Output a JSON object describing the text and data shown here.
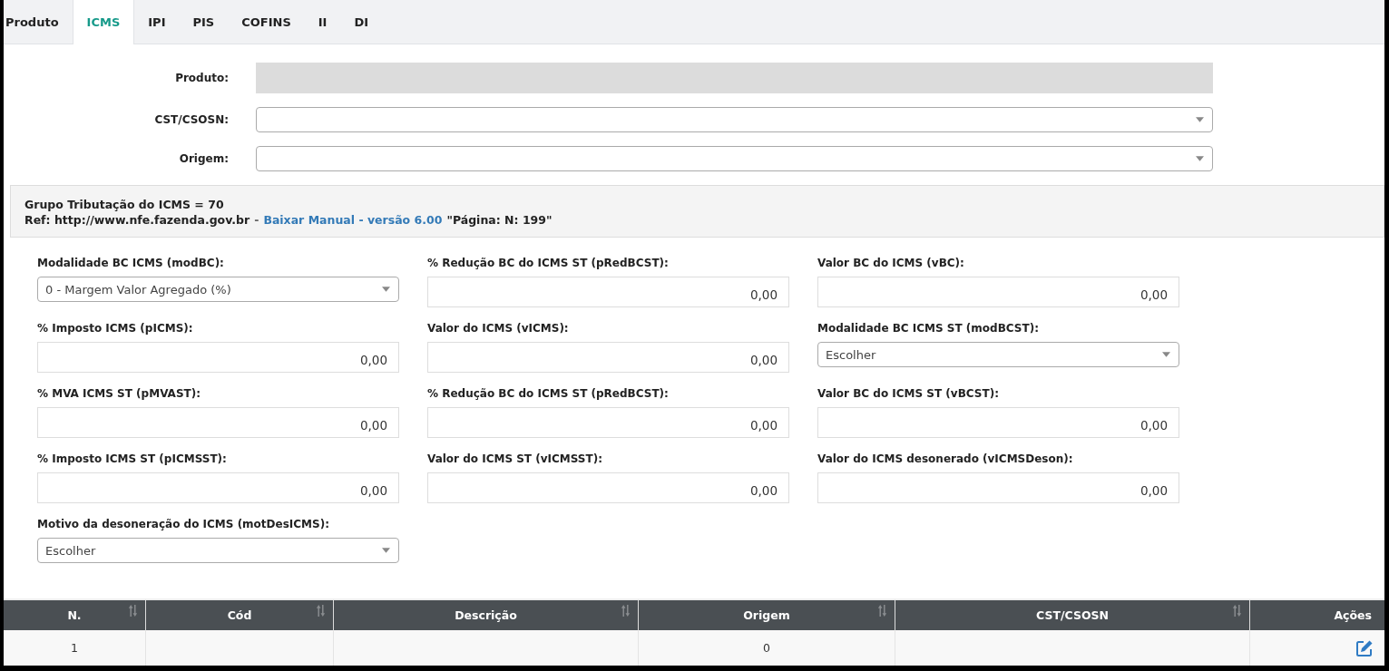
{
  "tabs": [
    {
      "label": "Produto",
      "selected": false
    },
    {
      "label": "ICMS",
      "selected": true
    },
    {
      "label": "IPI",
      "selected": false
    },
    {
      "label": "PIS",
      "selected": false
    },
    {
      "label": "COFINS",
      "selected": false
    },
    {
      "label": "II",
      "selected": false
    },
    {
      "label": "DI",
      "selected": false
    }
  ],
  "header_fields": [
    {
      "label": "Produto:",
      "kind": "text",
      "disabled": true
    },
    {
      "label": "CST/CSOSN:",
      "kind": "select",
      "disabled": false
    },
    {
      "label": "Origem:",
      "kind": "select",
      "disabled": false
    }
  ],
  "info_panel": {
    "title": "Grupo Tributação do ICMS = 70",
    "ref_prefix": "Ref: http://www.nfe.fazenda.gov.br",
    "separator": "-",
    "link": "Baixar Manual - versão 6.00",
    "ref_suffix": "\"Página: N: 199\""
  },
  "fields": [
    {
      "label": "Modalidade BC ICMS (modBC):",
      "kind": "select",
      "value": "0 - Margem Valor Agregado (%)"
    },
    {
      "label": "% Redução BC do ICMS ST (pRedBCST):",
      "kind": "number",
      "value": "0,00"
    },
    {
      "label": "Valor BC do ICMS (vBC):",
      "kind": "number",
      "value": "0,00"
    },
    {
      "label": "% Imposto ICMS (pICMS):",
      "kind": "number",
      "value": "0,00"
    },
    {
      "label": "Valor do ICMS (vICMS):",
      "kind": "number",
      "value": "0,00"
    },
    {
      "label": "Modalidade BC ICMS ST (modBCST):",
      "kind": "select",
      "value": "Escolher"
    },
    {
      "label": "% MVA ICMS ST (pMVAST):",
      "kind": "number",
      "value": "0,00"
    },
    {
      "label": "% Redução BC do ICMS ST (pRedBCST):",
      "kind": "number",
      "value": "0,00"
    },
    {
      "label": "Valor BC do ICMS ST (vBCST):",
      "kind": "number",
      "value": "0,00"
    },
    {
      "label": "% Imposto ICMS ST (pICMSST):",
      "kind": "number",
      "value": "0,00"
    },
    {
      "label": "Valor do ICMS ST (vICMSST):",
      "kind": "number",
      "value": "0,00"
    },
    {
      "label": "Valor do ICMS desonerado (vICMSDeson):",
      "kind": "number",
      "value": "0,00"
    },
    {
      "label": "Motivo da desoneração do ICMS (motDesICMS):",
      "kind": "select",
      "value": "Escolher"
    }
  ],
  "table": {
    "columns": [
      {
        "label": "N.",
        "sortable": true
      },
      {
        "label": "Cód",
        "sortable": true
      },
      {
        "label": "Descrição",
        "sortable": true
      },
      {
        "label": "Origem",
        "sortable": true
      },
      {
        "label": "CST/CSOSN",
        "sortable": true
      },
      {
        "label": "Ações",
        "sortable": false
      }
    ],
    "rows": [
      {
        "cells": [
          "1",
          null,
          null,
          "0",
          null
        ],
        "editable": true
      }
    ]
  }
}
